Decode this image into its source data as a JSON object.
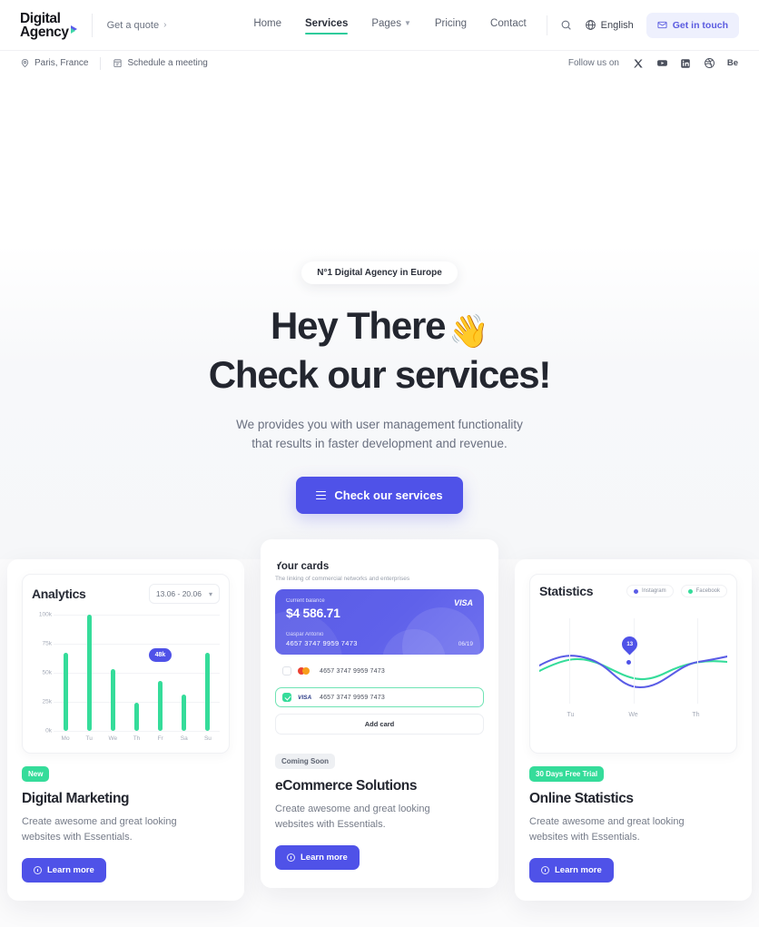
{
  "header": {
    "logo_line1": "Digital",
    "logo_line2": "Agency",
    "quote_link": "Get a quote",
    "quote_chevron": "›",
    "nav": [
      {
        "label": "Home",
        "active": false,
        "has_chevron": false
      },
      {
        "label": "Services",
        "active": true,
        "has_chevron": false
      },
      {
        "label": "Pages",
        "active": false,
        "has_chevron": true
      },
      {
        "label": "Pricing",
        "active": false,
        "has_chevron": false
      },
      {
        "label": "Contact",
        "active": false,
        "has_chevron": false
      }
    ],
    "search_icon": "search-icon",
    "language": "English",
    "language_icon": "globe-icon",
    "cta": "Get in touch",
    "cta_icon": "envelope-icon",
    "accent_active": "#2ecb9b",
    "cta_bg": "#eef0fd",
    "cta_color": "#5b5ce0"
  },
  "subbar": {
    "location": "Paris, France",
    "location_icon": "map-pin-icon",
    "schedule": "Schedule a meeting",
    "schedule_icon": "calendar-icon",
    "follow_label": "Follow us on",
    "socials": [
      {
        "name": "x-twitter-icon",
        "label": "X"
      },
      {
        "name": "youtube-icon",
        "label": "YouTube"
      },
      {
        "name": "linkedin-icon",
        "label": "LinkedIn"
      },
      {
        "name": "dribbble-icon",
        "label": "Dribbble"
      },
      {
        "name": "behance-icon",
        "label": "Be"
      }
    ]
  },
  "hero": {
    "badge": "N°1 Digital Agency in Europe",
    "title_line1": "Hey There",
    "wave_emoji": "👋",
    "title_line2": "Check our services!",
    "sub_line1": "We provides you with user management functionality",
    "sub_line2": "that results in faster development and revenue.",
    "button": "Check our services",
    "button_icon": "menu-icon",
    "button_bg": "#4f52e8"
  },
  "cards": [
    {
      "tag": "New",
      "tag_style": "green",
      "title": "Digital Marketing",
      "desc_line1": "Create awesome and great looking",
      "desc_line2": "websites with Essentials.",
      "button": "Learn more",
      "button_icon": "clock-icon"
    },
    {
      "tag": "Coming Soon",
      "tag_style": "gray",
      "title": "eCommerce Solutions",
      "desc_line1": "Create awesome and great looking",
      "desc_line2": "websites with Essentials.",
      "button": "Learn more",
      "button_icon": "clock-icon"
    },
    {
      "tag": "30 Days Free Trial",
      "tag_style": "green",
      "title": "Online Statistics",
      "desc_line1": "Create awesome and great looking",
      "desc_line2": "websites with Essentials.",
      "button": "Learn more",
      "button_icon": "clock-icon"
    }
  ],
  "analytics": {
    "title": "Analytics",
    "date_range": "13.06 - 20.06",
    "chevron": "⌄"
  },
  "wallet": {
    "title": "Your cards",
    "subtitle": "The linking of commercial networks and enterprises",
    "balance_label": "Current balance",
    "balance": "$4 586.71",
    "network": "VISA",
    "holder": "Gaspar Antonio",
    "number": "4657 3747 9959 7473",
    "expiry": "06/19",
    "rows": [
      {
        "brand": "mastercard-icon",
        "number": "4657 3747 9959 7473",
        "selected": false
      },
      {
        "brand": "visa-icon",
        "number": "4657 3747 9959 7473",
        "selected": true
      }
    ],
    "add_card": "Add card"
  },
  "statistics": {
    "title": "Statistics",
    "pin_value": "13"
  },
  "chart_data": [
    {
      "type": "bar",
      "title": "Analytics",
      "categories": [
        "Mo",
        "Tu",
        "We",
        "Th",
        "Fr",
        "Sa",
        "Su"
      ],
      "values": [
        67,
        100,
        53,
        24,
        43,
        31,
        67
      ],
      "ytick_labels": [
        "0k",
        "25k",
        "50k",
        "75k",
        "100k"
      ],
      "yticks": [
        0,
        25,
        50,
        75,
        100
      ],
      "ylim": [
        0,
        100
      ],
      "xlabel": "",
      "ylabel": "",
      "grid": true,
      "bar_color": "#35dc9a",
      "annotation": {
        "label": "48k",
        "category": "Fr",
        "color": "#4f52e8"
      }
    },
    {
      "type": "line",
      "title": "Statistics",
      "x": [
        "Tu",
        "We",
        "Th"
      ],
      "xtick_labels": [
        "Tu",
        "We",
        "Th"
      ],
      "legend": [
        "Instagram",
        "Facebook"
      ],
      "legend_position": "top-right",
      "grid": true,
      "series": [
        {
          "name": "Instagram",
          "color": "#5a5ce6",
          "values": [
            62,
            28,
            66
          ]
        },
        {
          "name": "Facebook",
          "color": "#35dc9a",
          "values": [
            40,
            72,
            52
          ]
        }
      ],
      "marker": {
        "label": "13",
        "color": "#4f52e8"
      }
    }
  ]
}
